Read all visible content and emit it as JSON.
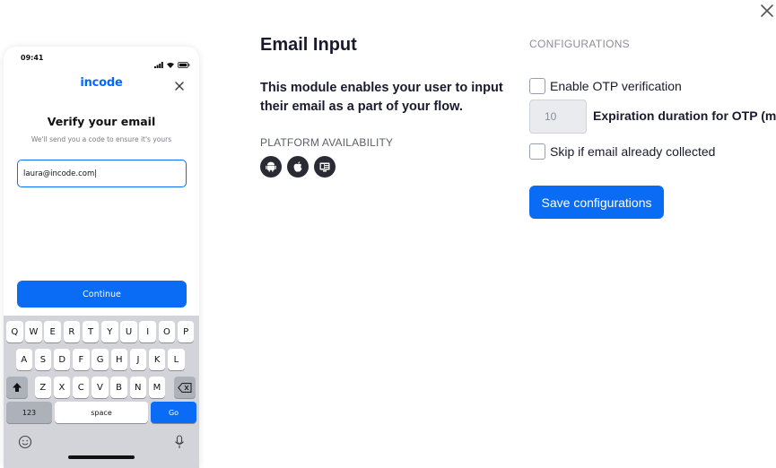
{
  "phone": {
    "time": "09:41",
    "logo": "incode",
    "title": "Verify your email",
    "subtitle": "We'll send you a code to ensure it's yours",
    "email_value": "laura@incode.com|",
    "continue_label": "Continue",
    "keyboard": {
      "row1": [
        "Q",
        "W",
        "E",
        "R",
        "T",
        "Y",
        "U",
        "I",
        "O",
        "P"
      ],
      "row2": [
        "A",
        "S",
        "D",
        "F",
        "G",
        "H",
        "J",
        "K",
        "L"
      ],
      "row3": [
        "Z",
        "X",
        "C",
        "V",
        "B",
        "N",
        "M"
      ],
      "numbers_label": "123",
      "space_label": "space",
      "go_label": "Go"
    }
  },
  "module": {
    "title": "Email Input",
    "description": "This module enables your user to input their email as a part of your flow.",
    "platform_label": "PLATFORM AVAILABILITY",
    "platforms": [
      "android-icon",
      "apple-icon",
      "web-icon"
    ]
  },
  "config": {
    "label": "CONFIGURATIONS",
    "otp_label": "Enable OTP verification",
    "otp_checked": false,
    "expiration_value": "10",
    "expiration_label": "Expiration duration for OTP (min)",
    "skip_label": "Skip if email already collected",
    "skip_checked": false,
    "save_label": "Save configurations"
  },
  "colors": {
    "accent": "#0a6cf5",
    "text": "#1a1a2e"
  }
}
